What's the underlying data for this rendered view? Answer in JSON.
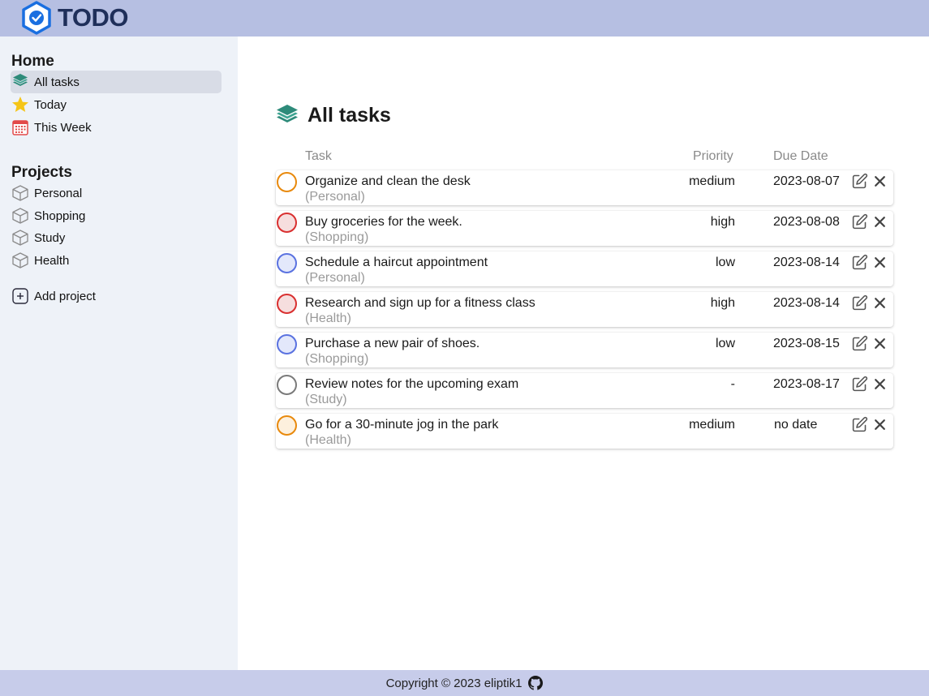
{
  "app": {
    "title": "TODO"
  },
  "sidebar": {
    "home_title": "Home",
    "home_items": [
      {
        "label": "All tasks",
        "icon": "layers-icon",
        "active": true
      },
      {
        "label": "Today",
        "icon": "star-icon"
      },
      {
        "label": "This Week",
        "icon": "calendar-icon"
      }
    ],
    "projects_title": "Projects",
    "projects": [
      {
        "label": "Personal",
        "icon": "cube-icon"
      },
      {
        "label": "Shopping",
        "icon": "cube-icon"
      },
      {
        "label": "Study",
        "icon": "cube-icon"
      },
      {
        "label": "Health",
        "icon": "cube-icon"
      }
    ],
    "add_project_label": "Add project"
  },
  "main": {
    "title": "All tasks",
    "columns": {
      "task": "Task",
      "priority": "Priority",
      "due": "Due Date"
    },
    "tasks": [
      {
        "name": "Organize and clean the desk",
        "project": "(Personal)",
        "priority": "medium",
        "due": "2023-08-07"
      },
      {
        "name": "Buy groceries for the week.",
        "project": "(Shopping)",
        "priority": "high",
        "due": "2023-08-08"
      },
      {
        "name": "Schedule a haircut appointment",
        "project": "(Personal)",
        "priority": "low",
        "due": "2023-08-14"
      },
      {
        "name": "Research and sign up for a fitness class",
        "project": "(Health)",
        "priority": "high",
        "due": "2023-08-14"
      },
      {
        "name": "Purchase a new pair of shoes.",
        "project": "(Shopping)",
        "priority": "low",
        "due": "2023-08-15"
      },
      {
        "name": "Review notes for the upcoming exam",
        "project": "(Study)",
        "priority": "-",
        "due": "2023-08-17"
      },
      {
        "name": "Go for a 30-minute jog in the park",
        "project": "(Health)",
        "priority": "medium",
        "due": "no date"
      }
    ]
  },
  "footer": {
    "copyright": "Copyright © 2023 eliptik1"
  },
  "colors": {
    "topbar": "#b6bfe2",
    "sidebar": "#eef2f8",
    "footer": "#c7ccea",
    "logo_blue": "#1a6fe0",
    "priority_medium": "#e8890c",
    "priority_high": "#d93030",
    "priority_low": "#5a72e0",
    "priority_none": "#7a7a7a",
    "accent_teal": "#2e8b7a"
  }
}
